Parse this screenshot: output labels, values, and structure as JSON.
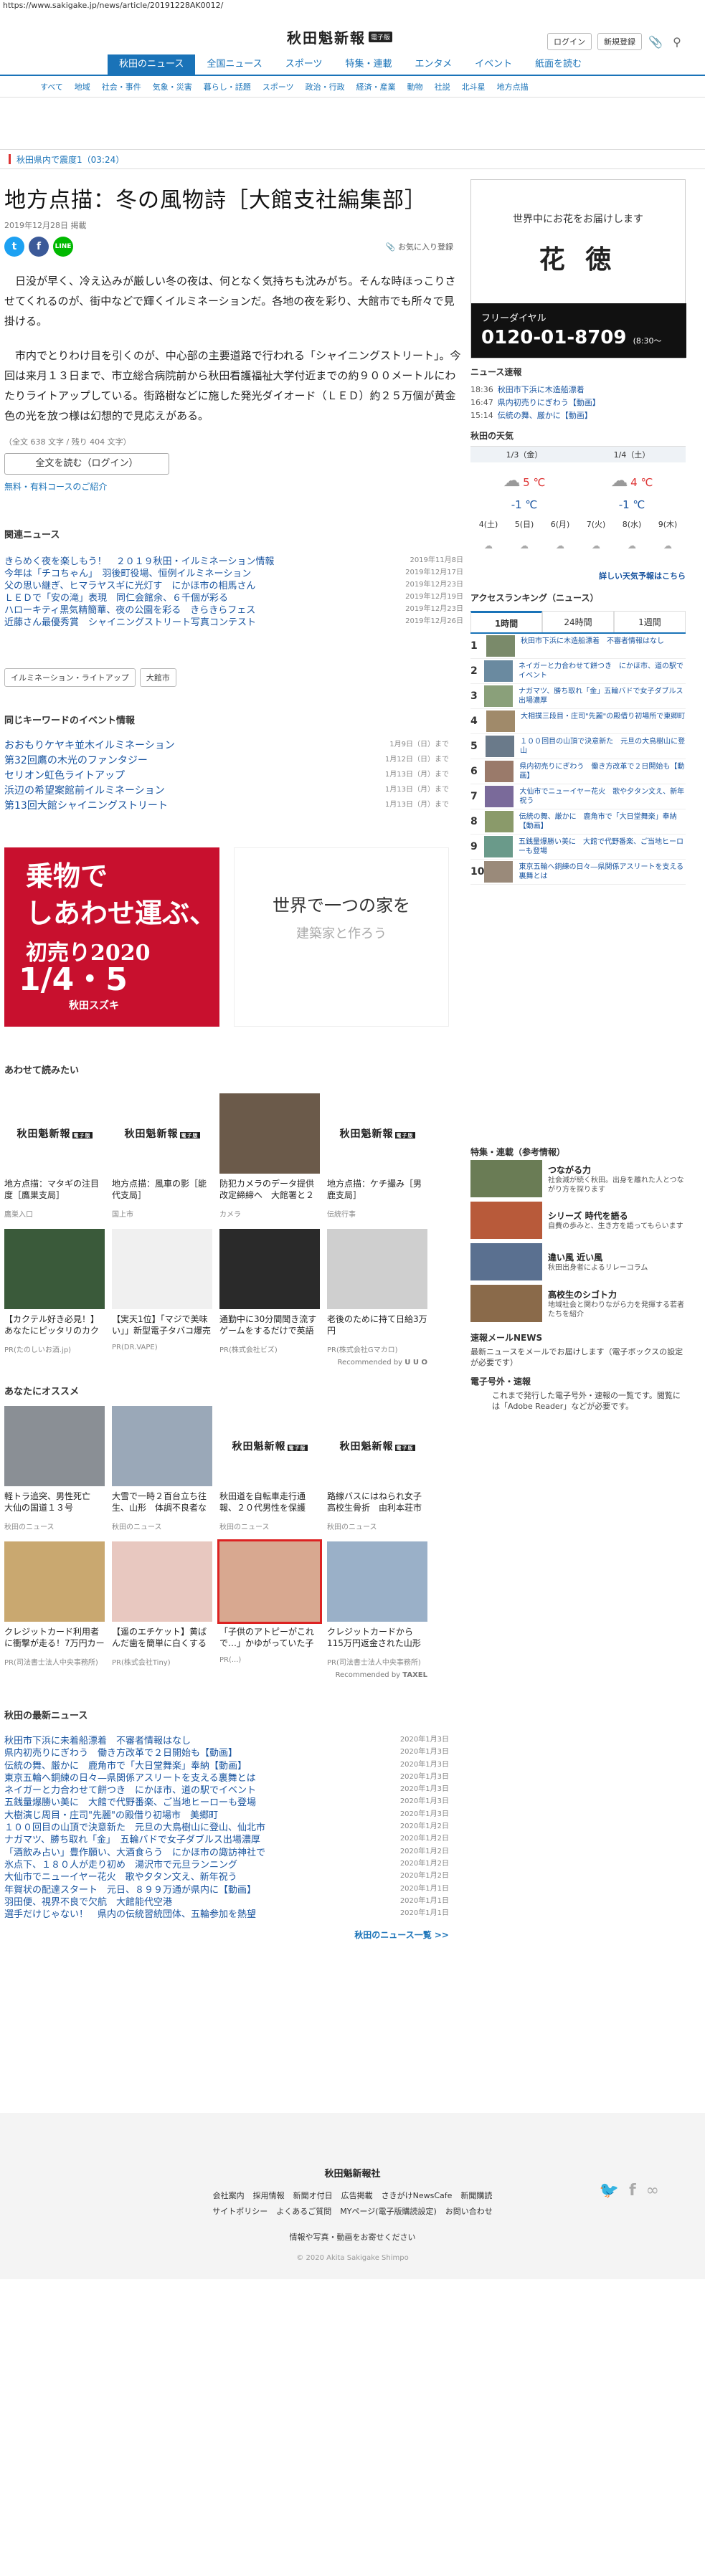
{
  "url": "https://www.sakigake.jp/news/article/20191228AK0012/",
  "header": {
    "logo": "秋田魁新報",
    "logo_badge": "電子版",
    "login": "ログイン",
    "register": "新規登録"
  },
  "nav": [
    "秋田のニュース",
    "全国ニュース",
    "スポーツ",
    "特集・連載",
    "エンタメ",
    "イベント",
    "紙面を読む"
  ],
  "subnav": [
    "すべて",
    "地域",
    "社会・事件",
    "気象・災害",
    "暮らし・話題",
    "スポーツ",
    "政治・行政",
    "経済・産業",
    "動物",
    "社説",
    "北斗星",
    "地方点描"
  ],
  "alert": "秋田県内で震度1（03:24）",
  "article": {
    "title": "地方点描：冬の風物詩［大館支社編集部］",
    "date": "2019年12月28日 掲載",
    "favorite": "お気に入り登録",
    "p1": "日没が早く、冷え込みが厳しい冬の夜は、何となく気持ちも沈みがち。そんな時ほっこりさせてくれるのが、街中などで輝くイルミネーションだ。各地の夜を彩り、大館市でも所々で見掛ける。",
    "p2": "市内でとりわけ目を引くのが、中心部の主要道路で行われる「シャイニングストリート」。今回は来月１３日まで、市立総合病院前から秋田看護福祉大学付近までの約９００メートルにわたりライトアップしている。街路樹などに施した発光ダイオード（ＬＥＤ）約２５万個が黄金色の光を放つ様は幻想的で見応えがある。",
    "charcount": "（全文 638 文字 / 残り 404 文字）",
    "login_btn": "全文を読む（ログイン）",
    "course_link": "無料・有料コースのご紹介"
  },
  "related": {
    "heading": "関連ニュース",
    "items": [
      {
        "t": "きらめく夜を楽しもう！　２０１９秋田・イルミネーション情報",
        "d": "2019年11月8日"
      },
      {
        "t": "今年は「チコちゃん」　羽後町役場、恒例イルミネーション",
        "d": "2019年12月17日"
      },
      {
        "t": "父の思い継ぎ、ヒマラヤスギに光灯す　にかほ市の相馬さん",
        "d": "2019年12月23日"
      },
      {
        "t": "ＬＥＤで「安の滝」表現　同仁会館余、６千個が彩る",
        "d": "2019年12月19日"
      },
      {
        "t": "ハローキティ黒気精簡華、夜の公園を彩る　きらきらフェス",
        "d": "2019年12月23日"
      },
      {
        "t": "近藤さん最優秀賞　シャイニングストリート写真コンテスト",
        "d": "2019年12月26日"
      }
    ]
  },
  "tags": [
    "イルミネーション・ライトアップ",
    "大館市"
  ],
  "events": {
    "heading": "同じキーワードのイベント情報",
    "items": [
      {
        "t": "おおもりケヤキ並木イルミネーション",
        "d": "1月9日（日）まで"
      },
      {
        "t": "第32回鷹の木光のファンタジー",
        "d": "1月12日（日）まで"
      },
      {
        "t": "セリオン虹色ライトアップ",
        "d": "1月13日（月）まで"
      },
      {
        "t": "浜辺の希望案館前イルミネーション",
        "d": "1月13日（月）まで"
      },
      {
        "t": "第13回大館シャイニングストリート",
        "d": "1月13日（月）まで"
      }
    ]
  },
  "ads": {
    "ad1_line1": "乗物で",
    "ad1_line2": "しあわせ運ぶ、",
    "ad1_line3": "初売り2020",
    "ad1_date": "1/4・5",
    "ad1_brand": "秋田スズキ",
    "ad2_line1": "世界で一つの家を",
    "ad2_line2": "建築家と作ろう"
  },
  "also_read": {
    "heading": "あわせて読みたい",
    "items": [
      {
        "t": "地方点描：マタギの注目度［鷹巣支局］",
        "s": "鷹巣入口"
      },
      {
        "t": "地方点描：風車の影［能代支局］",
        "s": "国上市"
      },
      {
        "t": "防犯カメラのデータ提供改定締締へ　大館署と２業工団体",
        "s": "カメラ"
      },
      {
        "t": "地方点描：ケチ撮み［男鹿支局］",
        "s": "伝統行事"
      },
      {
        "t": "【カクテル好き必見！】あなたにピッタリのカクテルはどれ!?",
        "s": "PR(たのしいお酒.jp)"
      },
      {
        "t": "【実天1位】「マジで美味い」」新型電子タバコ爆売れの秘密とは",
        "s": "PR(DR.VAPE)"
      },
      {
        "t": "通勤中に30分間聞き流すゲームをするだけで英語がネイティブ並み…",
        "s": "PR(株式会社ビズ)"
      },
      {
        "t": "老後のために持て日給3万円",
        "s": "PR(株式会社Gマカロ)"
      }
    ],
    "rec": "Recommended by"
  },
  "osusume": {
    "heading": "あなたにオススメ",
    "items": [
      {
        "t": "軽トラ追突、男性死亡　大仙の国道１３号",
        "s": "秋田のニュース"
      },
      {
        "t": "大雪で一時２百台立ち往生、山形　体調不良者なし",
        "s": "秋田のニュース"
      },
      {
        "t": "秋田道を自転車走行通報、２０代男性を保護",
        "s": "秋田のニュース"
      },
      {
        "t": "路線バスにはねられ女子高校生骨折　由利本荘市",
        "s": "秋田のニュース"
      },
      {
        "t": "クレジットカード利用者に衝撃が走る！7万円カード別の平均返金額…",
        "s": "PR(司法書士法人中央事務所)"
      },
      {
        "t": "【遥のエチケット】黄ばんだ歯を簡単に白くする方法がスゴイ！",
        "s": "PR(株式会社Tiny)"
      },
      {
        "t": "「子供のアトピーがこれで…」かゆがっていた子供の石鹸…",
        "s": "PR(...)"
      },
      {
        "t": "クレジットカードから115万円返金された山形県（68）男性",
        "s": "PR(司法書士法人中央事務所)"
      }
    ],
    "rec": "Recommended by"
  },
  "latest": {
    "heading": "秋田の最新ニュース",
    "items": [
      {
        "t": "秋田市下浜に未着船漂着　不審者情報はなし",
        "d": "2020年1月3日"
      },
      {
        "t": "県内初売りにぎわう　働き方改革で２日開始も【動画】",
        "d": "2020年1月3日"
      },
      {
        "t": "伝統の舞、厳かに　鹿角市で「大日堂舞楽」奉納【動画】",
        "d": "2020年1月3日"
      },
      {
        "t": "東京五輪へ銅練の日々—県関係アスリートを支える裏舞とは",
        "d": "2020年1月3日"
      },
      {
        "t": "ネイガーと力合わせて餅つき　にかほ市、道の駅でイベント",
        "d": "2020年1月3日"
      },
      {
        "t": "五銭量爆勝い美に　大館で代野番楽、ご当地ヒーローも登場",
        "d": "2020年1月3日"
      },
      {
        "t": "大樹演じ周目・庄司\"先麗\"の殿借り初場市　美郷町",
        "d": "2020年1月3日"
      },
      {
        "t": "１００回目の山頂で決意新た　元旦の大鳥樹山に登山、仙北市",
        "d": "2020年1月2日"
      },
      {
        "t": "ナガマツ、勝ち取れ「金」　五輪バドで女子ダブルス出場濃厚",
        "d": "2020年1月2日"
      },
      {
        "t": "「酒飲み占い」豊作願い、大酒食らう　にかほ市の諏訪神社で",
        "d": "2020年1月2日"
      },
      {
        "t": "氷点下、１８０人が走り初め　湯沢市で元旦ランニング",
        "d": "2020年1月2日"
      },
      {
        "t": "大仙市でニューイヤー花火　歌や夕タン文え、新年祝う",
        "d": "2020年1月2日"
      },
      {
        "t": "年賀状の配達スタート　元日、８９９万通が県内に【動画】",
        "d": "2020年1月1日"
      },
      {
        "t": "羽田便、視界不良で欠航　大館能代空港",
        "d": "2020年1月1日"
      },
      {
        "t": "選手だけじゃない！　県内の伝統習統団体、五輪参加を熱望",
        "d": "2020年1月1日"
      }
    ],
    "more": "秋田のニュース一覧 >>"
  },
  "side": {
    "ad_t1": "世界中にお花をお届けします",
    "ad_t2": "花 徳",
    "ad_fd": "フリーダイヤル",
    "ad_num": "0120-01-8709",
    "ad_hours": "(8:30～19:00)",
    "sokuho_h": "ニュース速報",
    "sokuho": [
      {
        "tm": "18:36",
        "t": "秋田市下浜に木造船漂着"
      },
      {
        "tm": "16:47",
        "t": "県内初売りにぎわう【動画】"
      },
      {
        "tm": "15:14",
        "t": "伝統の舞、厳かに【動画】"
      }
    ],
    "weather_h": "秋田の天気",
    "w_days": [
      "1/3（金）",
      "1/4（土）"
    ],
    "w_hi": [
      "5 ℃",
      "4 ℃"
    ],
    "w_lo": [
      "-1 ℃",
      "-1 ℃"
    ],
    "w_week": [
      "4(土)",
      "5(日)",
      "6(月)",
      "7(火)",
      "8(水)",
      "9(木)"
    ],
    "w_link": "詳しい天気予報はこちら",
    "rank_h": "アクセスランキング（ニュース）",
    "rank_tabs": [
      "1時間",
      "24時間",
      "1週間"
    ],
    "rank": [
      "秋田市下浜に木造船漂着　不審者情報はなし",
      "ネイガーと力合わせて餅つき　にかほ市、道の駅でイベント",
      "ナガマツ、勝ち取れ「金」五輪バドで女子ダブルス出場濃厚",
      "大相撲三段目・庄司\"先麗\"の殿借り初場所で東卿町",
      "１００回目の山頂で決意新た　元旦の大鳥樹山に登山",
      "県内初売りにぎわう　働き方改革で２日開始も【動画】",
      "大仙市でニューイヤー花火　歌や夕タン文え、新年祝う",
      "伝統の舞、厳かに　鹿角市で「大日堂舞楽」奉納【動画】",
      "五銭量爆勝い美に　大館で代野番楽、ご当地ヒーローも登場",
      "東京五輪へ銅練の日々―県関係アスリートを支える裏舞とは"
    ],
    "special_h": "特集・連載（参考情報）",
    "special": [
      {
        "t": "つながる力",
        "s": "社会減が続く秋田。出身を離れた人とつながり方を探ります"
      },
      {
        "t": "シリーズ 時代を語る",
        "s": "自費の歩みと、生き方を語ってもらいます"
      },
      {
        "t": "違い風 近い風",
        "s": "秋田出身者によるリレーコラム"
      },
      {
        "t": "高校生のシゴト力",
        "s": "地域社会と関わりながら力を発揮する若者たちを紹介"
      }
    ],
    "mail_h": "速報メールNEWS",
    "mail_d": "最新ニュースをメールでお届けします（電子ボックスの設定が必要です）",
    "emag_h": "電子号外・速報",
    "emag_d": "これまで発行した電子号外・速報の一覧です。閲覧には「Adobe Reader」などが必要です。"
  },
  "footer": {
    "name": "秋田魁新報社",
    "links1": [
      "会社案内",
      "採用情報",
      "新聞オ付日",
      "広告掲載",
      "さきがけNewsCafe",
      "新聞購読"
    ],
    "links2": [
      "サイトポリシー",
      "よくあるご質問",
      "MYページ(電子版購読設定)",
      "お問い合わせ"
    ],
    "info": "情報や写真・動画をお寄せください",
    "copyright": "© 2020 Akita Sakigake Shimpo"
  }
}
